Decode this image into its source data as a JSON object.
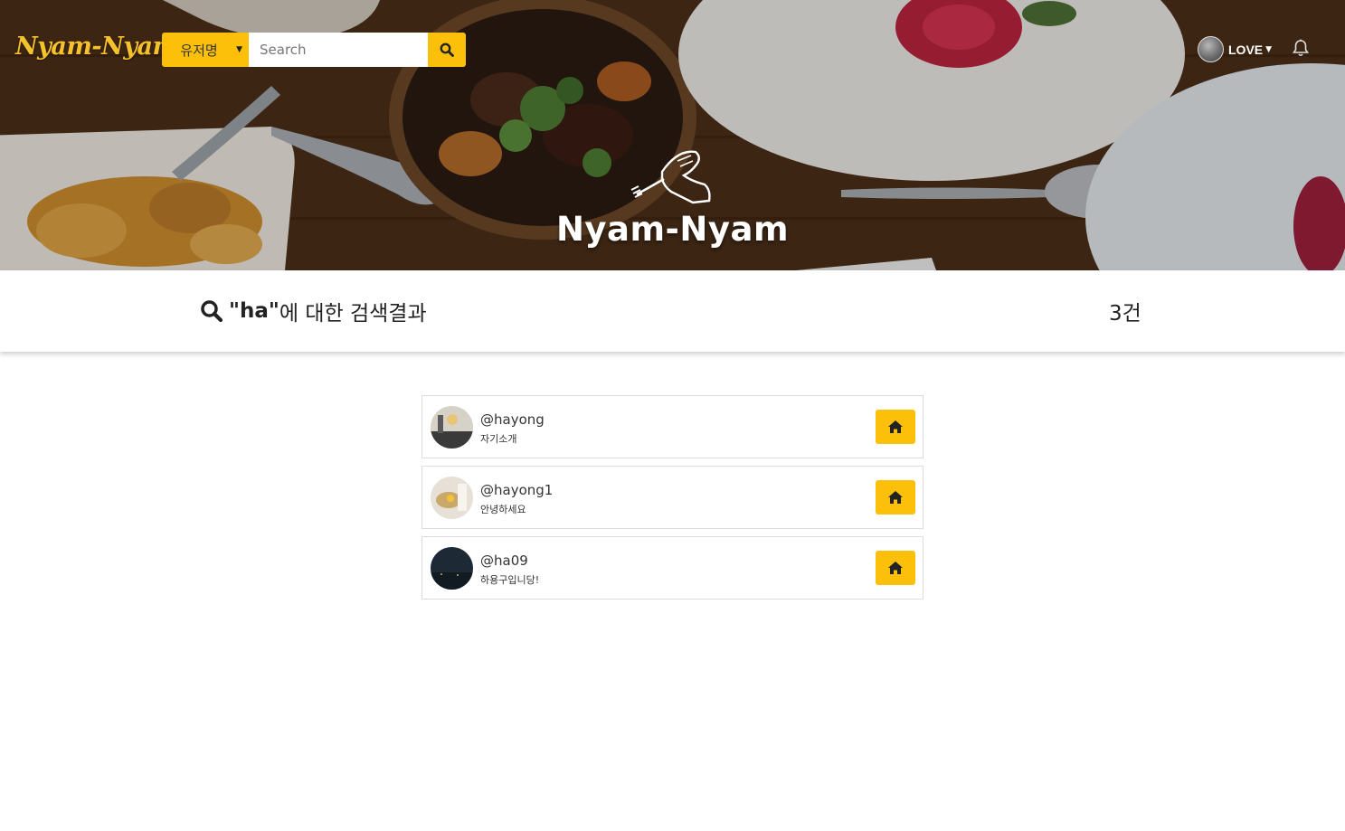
{
  "header": {
    "brand": "Nyam-Nyam",
    "search": {
      "type_selected": "유저명",
      "placeholder": "Search",
      "value": ""
    },
    "user": {
      "name": "LOVE"
    }
  },
  "hero": {
    "title": "Nyam-Nyam"
  },
  "results": {
    "query_display": "\"ha\"",
    "suffix": "에 대한 검색결과",
    "count": "3건"
  },
  "users": [
    {
      "handle": "@hayong",
      "bio": "자기소개"
    },
    {
      "handle": "@hayong1",
      "bio": "안녕하세요"
    },
    {
      "handle": "@ha09",
      "bio": "하용구입니당!"
    }
  ],
  "colors": {
    "accent": "#fcc00b",
    "brand": "#f6c22b"
  }
}
